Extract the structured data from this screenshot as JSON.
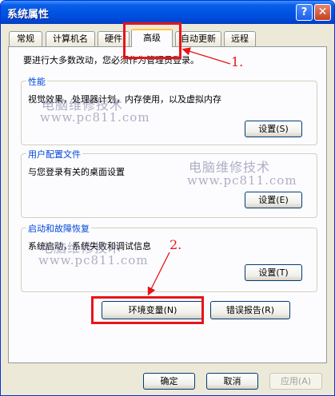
{
  "window": {
    "title": "系统属性",
    "help_glyph": "?",
    "close_glyph": "✕"
  },
  "tabs": [
    {
      "label": "常规"
    },
    {
      "label": "计算机名"
    },
    {
      "label": "硬件"
    },
    {
      "label": "高级",
      "active": true
    },
    {
      "label": "自动更新"
    },
    {
      "label": "远程"
    }
  ],
  "panel": {
    "intro": "要进行大多数改动，您必须作为管理员登录。",
    "performance": {
      "title": "性能",
      "desc": "视觉效果，处理器计划，内存使用，以及虚拟内存",
      "button": "设置(S)"
    },
    "profile": {
      "title": "用户配置文件",
      "desc": "与您登录有关的桌面设置",
      "button": "设置(E)"
    },
    "startup": {
      "title": "启动和故障恢复",
      "desc": "系统启动，系统失败和调试信息",
      "button": "设置(T)"
    },
    "env_button": "环境变量(N)",
    "error_button": "错误报告(R)"
  },
  "footer": {
    "ok": "确定",
    "cancel": "取消",
    "apply": "应用(A)"
  },
  "watermark": {
    "text": "电脑维修技术",
    "url": "www.pc811.com"
  },
  "annotations": {
    "step1": "1.",
    "step2": "2."
  },
  "colors": {
    "highlight": "#e8141a",
    "group_title": "#0046d5",
    "titlebar": "#0054e3"
  }
}
